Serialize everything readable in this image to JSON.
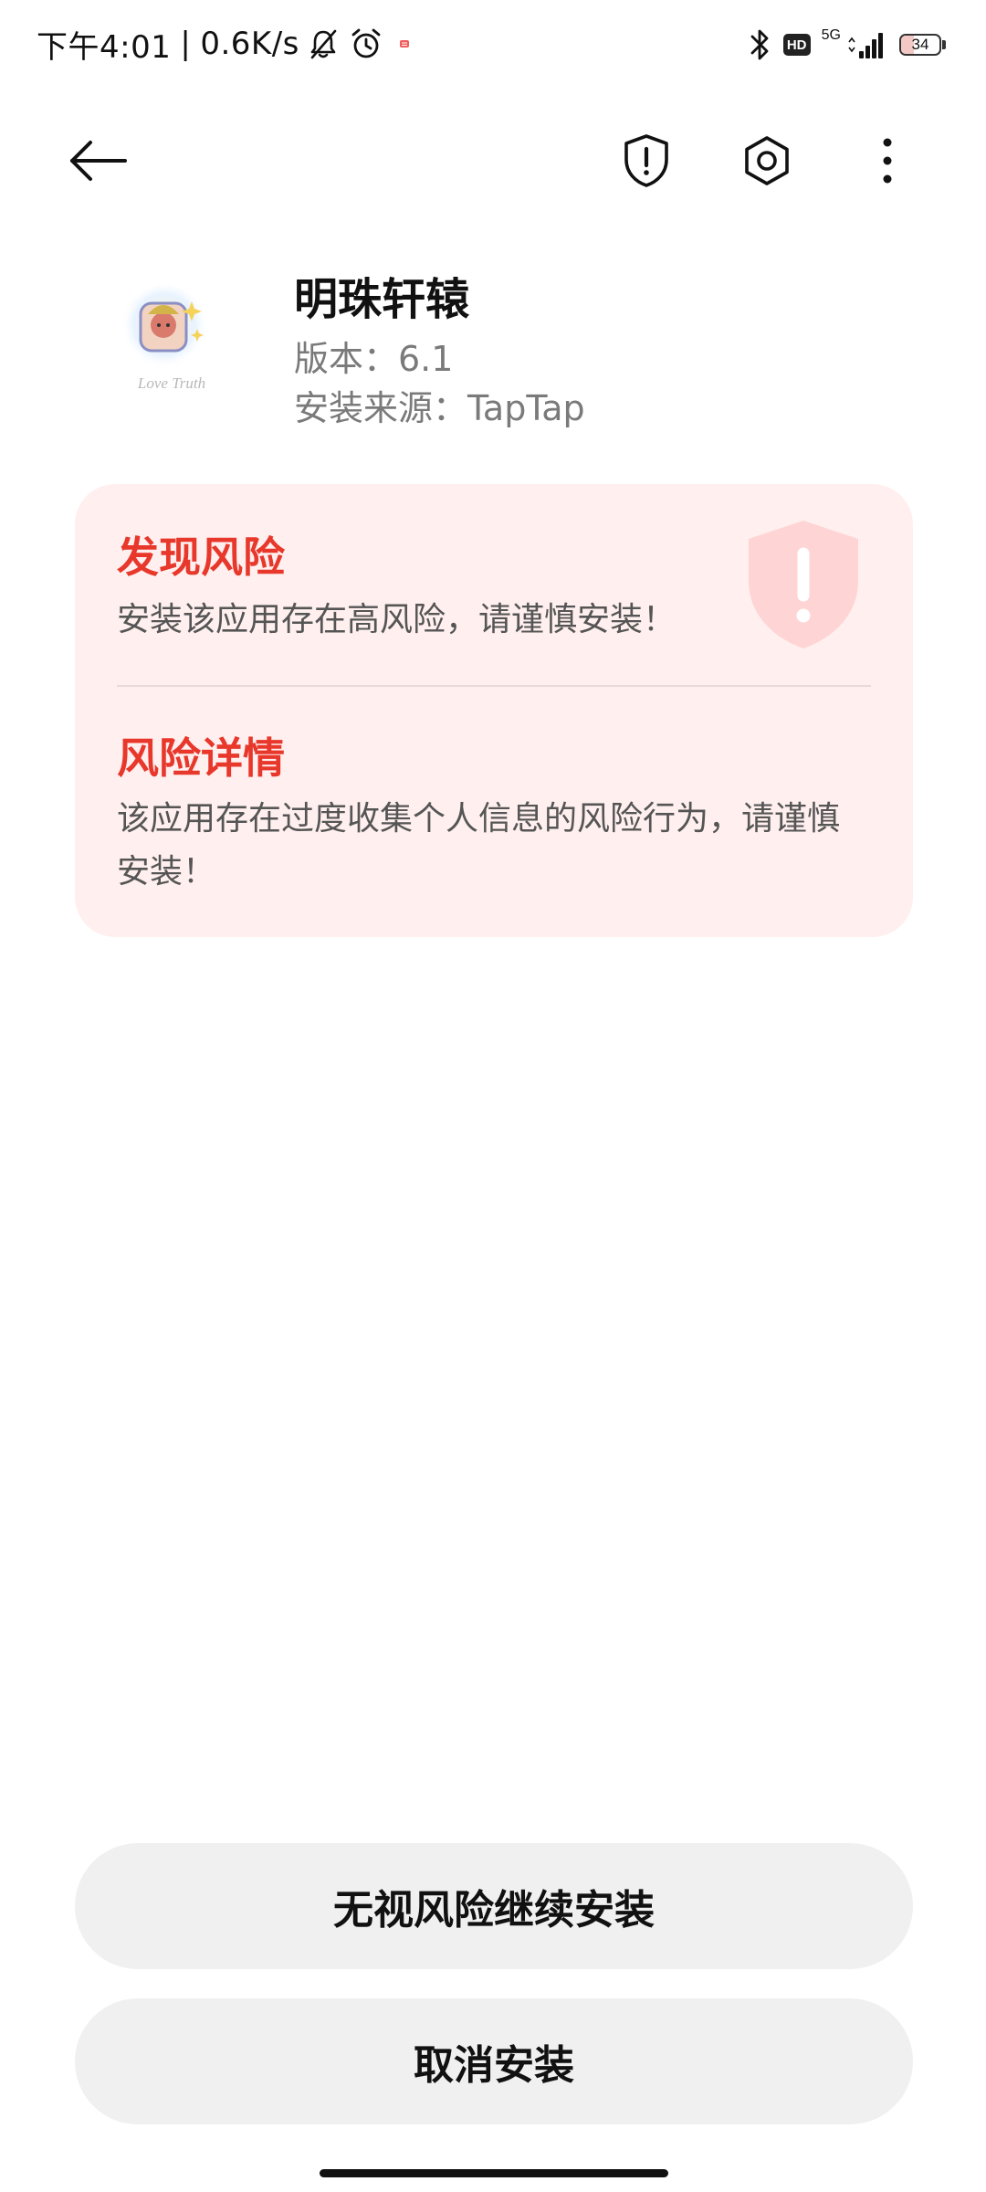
{
  "status_bar": {
    "time": "下午4:01",
    "separator": "|",
    "net_speed": "0.6K/s",
    "network_type": "5G",
    "hd_label": "HD",
    "battery_level": "34",
    "battery_fraction": 0.34
  },
  "app": {
    "name": "明珠轩辕",
    "version": "版本：6.1",
    "source": "安装来源：TapTap",
    "icon_watermark": "Love Truth"
  },
  "risk": {
    "title": "发现风险",
    "description": "安装该应用存在高风险，请谨慎安装！",
    "details_title": "风险详情",
    "details_description": "该应用存在过度收集个人信息的风险行为，请谨慎安装！"
  },
  "actions": {
    "continue_label": "无视风险继续安装",
    "cancel_label": "取消安装"
  },
  "colors": {
    "risk_red": "#e8372b",
    "card_background": "#fff0ef",
    "button_background": "#f0f0f0"
  }
}
